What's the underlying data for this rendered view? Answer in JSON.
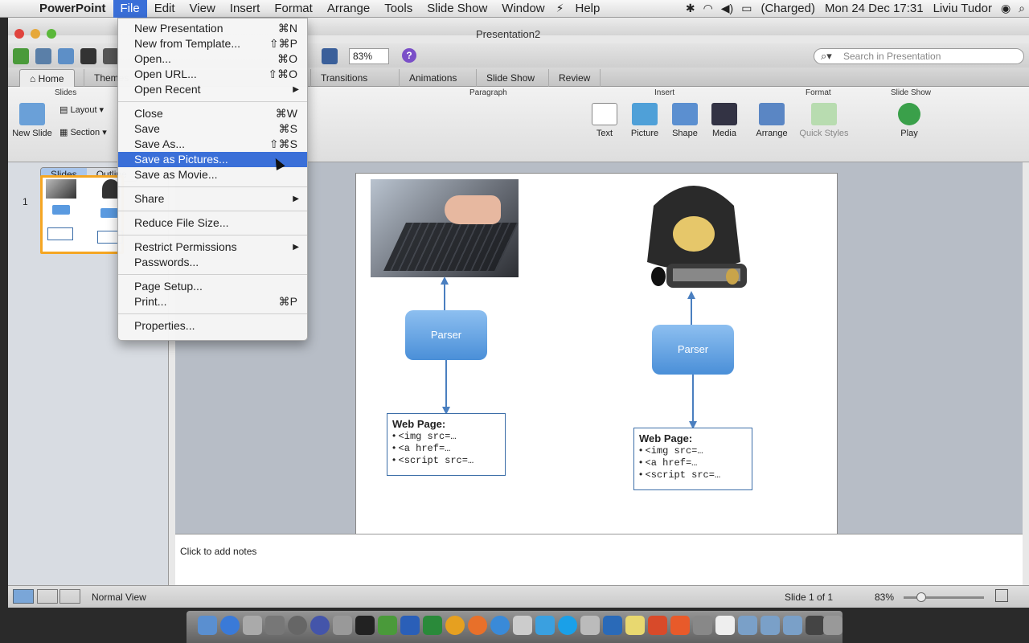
{
  "menubar": {
    "app": "PowerPoint",
    "items": [
      "File",
      "Edit",
      "View",
      "Insert",
      "Format",
      "Arrange",
      "Tools",
      "Slide Show",
      "Window",
      "Help"
    ],
    "battery": "(Charged)",
    "clock": "Mon 24 Dec  17:31",
    "user": "Liviu Tudor"
  },
  "window": {
    "title": "Presentation2",
    "zoom": "83%",
    "search_placeholder": "Search in Presentation"
  },
  "ribbon": {
    "tabs": [
      "Home",
      "Themes",
      "Transitions",
      "Animations",
      "Slide Show",
      "Review"
    ],
    "groups": {
      "slides": "Slides",
      "paragraph": "Paragraph",
      "insert": "Insert",
      "format": "Format",
      "slideshow": "Slide Show"
    },
    "buttons": {
      "new_slide": "New Slide",
      "layout": "Layout",
      "section": "Section",
      "text": "Text",
      "picture": "Picture",
      "shape": "Shape",
      "media": "Media",
      "arrange": "Arrange",
      "quick_styles": "Quick Styles",
      "play": "Play"
    }
  },
  "leftpane": {
    "tabs": [
      "Slides",
      "Outline"
    ],
    "slide_number": "1"
  },
  "file_menu": {
    "groups": [
      [
        {
          "label": "New Presentation",
          "shortcut": "⌘N"
        },
        {
          "label": "New from Template...",
          "shortcut": "⇧⌘P"
        },
        {
          "label": "Open...",
          "shortcut": "⌘O"
        },
        {
          "label": "Open URL...",
          "shortcut": "⇧⌘O"
        },
        {
          "label": "Open Recent",
          "submenu": true
        }
      ],
      [
        {
          "label": "Close",
          "shortcut": "⌘W"
        },
        {
          "label": "Save",
          "shortcut": "⌘S"
        },
        {
          "label": "Save As...",
          "shortcut": "⇧⌘S"
        },
        {
          "label": "Save as Pictures...",
          "highlighted": true
        },
        {
          "label": "Save as Movie..."
        }
      ],
      [
        {
          "label": "Share",
          "submenu": true
        }
      ],
      [
        {
          "label": "Reduce File Size..."
        }
      ],
      [
        {
          "label": "Restrict Permissions",
          "submenu": true
        },
        {
          "label": "Passwords..."
        }
      ],
      [
        {
          "label": "Page Setup..."
        },
        {
          "label": "Print...",
          "shortcut": "⌘P"
        }
      ],
      [
        {
          "label": "Properties..."
        }
      ]
    ]
  },
  "slide": {
    "parser_label": "Parser",
    "webpage_title": "Web Page:",
    "webpage_items": [
      "<img src=…",
      "<a href=…",
      "<script src=…"
    ]
  },
  "notes": {
    "placeholder": "Click to add notes"
  },
  "status": {
    "view": "Normal View",
    "slide_info": "Slide 1 of 1",
    "zoom": "83%"
  },
  "colors": {
    "accent": "#3a6fd8",
    "parser_top": "#8dbff0",
    "parser_bottom": "#4a8fd8",
    "thumb_border": "#f5a623"
  }
}
